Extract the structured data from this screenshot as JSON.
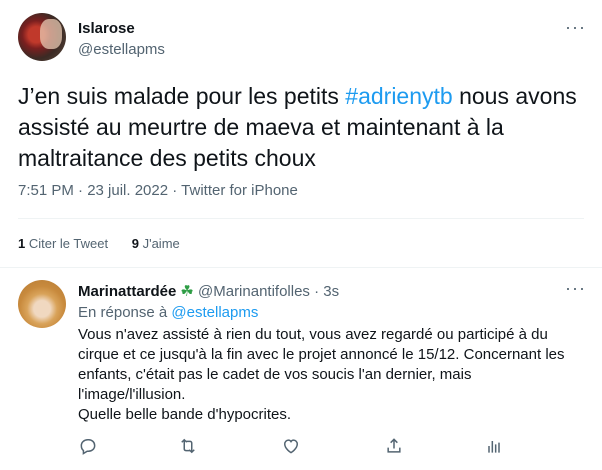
{
  "tweet": {
    "author_name": "Islarose",
    "author_handle": "@estellapms",
    "text_before": "J’en suis malade pour les petits ",
    "hashtag": "#adrienytb",
    "text_after": " nous avons assisté au meurtre de maeva et maintenant à la maltraitance des petits choux",
    "timestamp": "7:51 PM · 23 juil. 2022 · Twitter for iPhone",
    "retweets_count": "1",
    "retweets_label": "Citer le Tweet",
    "likes_count": "9",
    "likes_label": "J'aime",
    "more_label": "···"
  },
  "reply": {
    "author_name": "Marinattardée",
    "author_emoji": "☘",
    "author_handle": "@Marinantifolles",
    "time": "· 3s",
    "replying_prefix": "En réponse à ",
    "replying_to": "@estellapms",
    "text_lines": [
      "Vous n'avez assisté à rien du tout, vous avez regardé ou participé à du",
      "cirque et ce jusqu'à la fin avec le projet annoncé le 15/12. Concernant les",
      "enfants, c'était pas le cadet de vos soucis l'an dernier, mais",
      "l'image/l'illusion.",
      "Quelle belle bande d'hypocrites."
    ],
    "more_label": "···",
    "actions": [
      "reply-icon",
      "retweet-icon",
      "like-icon",
      "share-icon",
      "analytics-icon"
    ]
  },
  "colors": {
    "text": "#0f1419",
    "secondary": "#536471",
    "link": "#1d9bf0",
    "divider": "#eff3f4"
  }
}
